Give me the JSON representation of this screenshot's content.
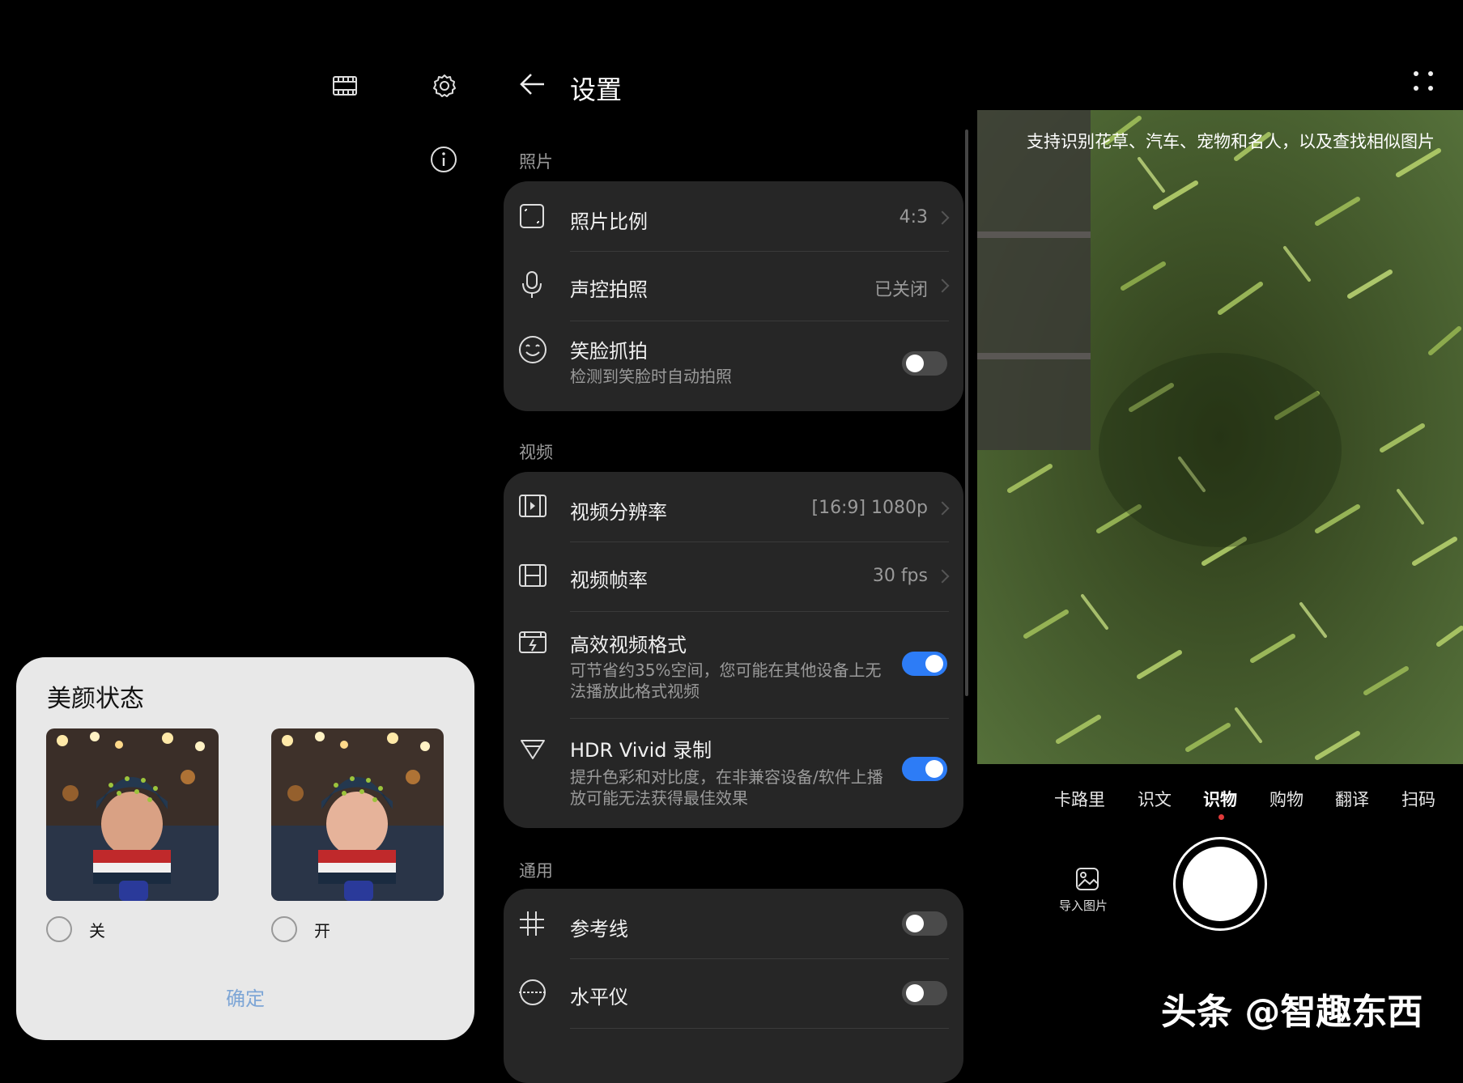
{
  "top_left": {
    "film_icon": "film-icon",
    "settings_icon": "gear-icon",
    "info_icon": "info-icon"
  },
  "beauty_dialog": {
    "title": "美颜状态",
    "options": [
      {
        "label": "关",
        "selected": false
      },
      {
        "label": "开",
        "selected": false
      }
    ],
    "confirm_label": "确定"
  },
  "settings": {
    "header_title": "设置",
    "sections": {
      "photo": {
        "title": "照片",
        "items": [
          {
            "label": "照片比例",
            "value": "4:3",
            "icon": "aspect-ratio-icon"
          },
          {
            "label": "声控拍照",
            "value": "已关闭",
            "icon": "microphone-icon"
          },
          {
            "label": "笑脸抓拍",
            "sub": "检测到笑脸时自动拍照",
            "toggle": false,
            "icon": "smile-icon"
          }
        ]
      },
      "video": {
        "title": "视频",
        "items": [
          {
            "label": "视频分辨率",
            "value": "[16:9] 1080p",
            "icon": "video-resolution-icon"
          },
          {
            "label": "视频帧率",
            "value": "30 fps",
            "icon": "video-framerate-icon"
          },
          {
            "label": "高效视频格式",
            "sub": "可节省约35%空间，您可能在其他设备上无法播放此格式视频",
            "toggle": true,
            "icon": "video-format-icon"
          },
          {
            "label": "HDR Vivid 录制",
            "sub": "提升色彩和对比度，在非兼容设备/软件上播放可能无法获得最佳效果",
            "toggle": true,
            "icon": "hdr-icon"
          }
        ]
      },
      "general": {
        "title": "通用",
        "items": [
          {
            "label": "参考线",
            "toggle": false,
            "icon": "grid-icon"
          },
          {
            "label": "水平仪",
            "toggle": false,
            "icon": "level-icon"
          }
        ]
      }
    }
  },
  "camera": {
    "hint": "支持识别花草、汽车、宠物和名人，以及查找相似图片",
    "modes": [
      "卡路里",
      "识文",
      "识物",
      "购物",
      "翻译",
      "扫码"
    ],
    "active_mode": "识物",
    "import_label": "导入图片"
  },
  "watermark": "头条 @智趣东西",
  "colors": {
    "accent": "#2d7cf6",
    "card_bg": "#262626",
    "dialog_bg": "#e8e8e8",
    "confirm": "#7ea6d6"
  }
}
